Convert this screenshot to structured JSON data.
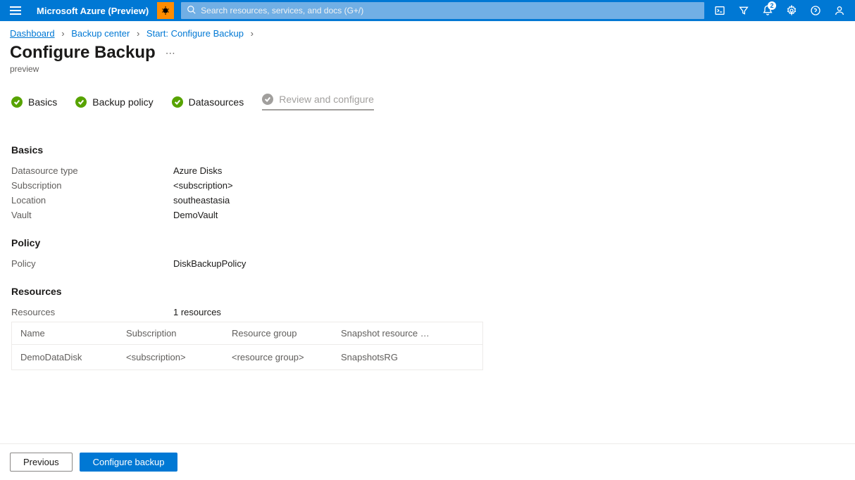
{
  "topbar": {
    "brand": "Microsoft Azure (Preview)",
    "search_placeholder": "Search resources, services, and docs (G+/)",
    "notification_count": "2"
  },
  "breadcrumb": {
    "dashboard": "Dashboard",
    "backup_center": "Backup center",
    "start": "Start: Configure Backup"
  },
  "page": {
    "title": "Configure Backup",
    "subtitle": "preview"
  },
  "steps": {
    "basics": "Basics",
    "policy": "Backup policy",
    "datasources": "Datasources",
    "review": "Review and configure"
  },
  "basics": {
    "heading": "Basics",
    "rows": {
      "datasource_type_label": "Datasource type",
      "datasource_type_value": "Azure Disks",
      "subscription_label": "Subscription",
      "subscription_value": "<subscription>",
      "location_label": "Location",
      "location_value": "southeastasia",
      "vault_label": "Vault",
      "vault_value": "DemoVault"
    }
  },
  "policy": {
    "heading": "Policy",
    "rows": {
      "policy_label": "Policy",
      "policy_value": "DiskBackupPolicy"
    }
  },
  "resources": {
    "heading": "Resources",
    "summary_label": "Resources",
    "summary_value": "1 resources",
    "columns": {
      "name": "Name",
      "subscription": "Subscription",
      "resource_group": "Resource group",
      "snapshot": "Snapshot resource …"
    },
    "rows": [
      {
        "name": "DemoDataDisk",
        "subscription": "<subscription>",
        "resource_group": "<resource group>",
        "snapshot": "SnapshotsRG"
      }
    ]
  },
  "footer": {
    "previous": "Previous",
    "configure": "Configure backup"
  }
}
